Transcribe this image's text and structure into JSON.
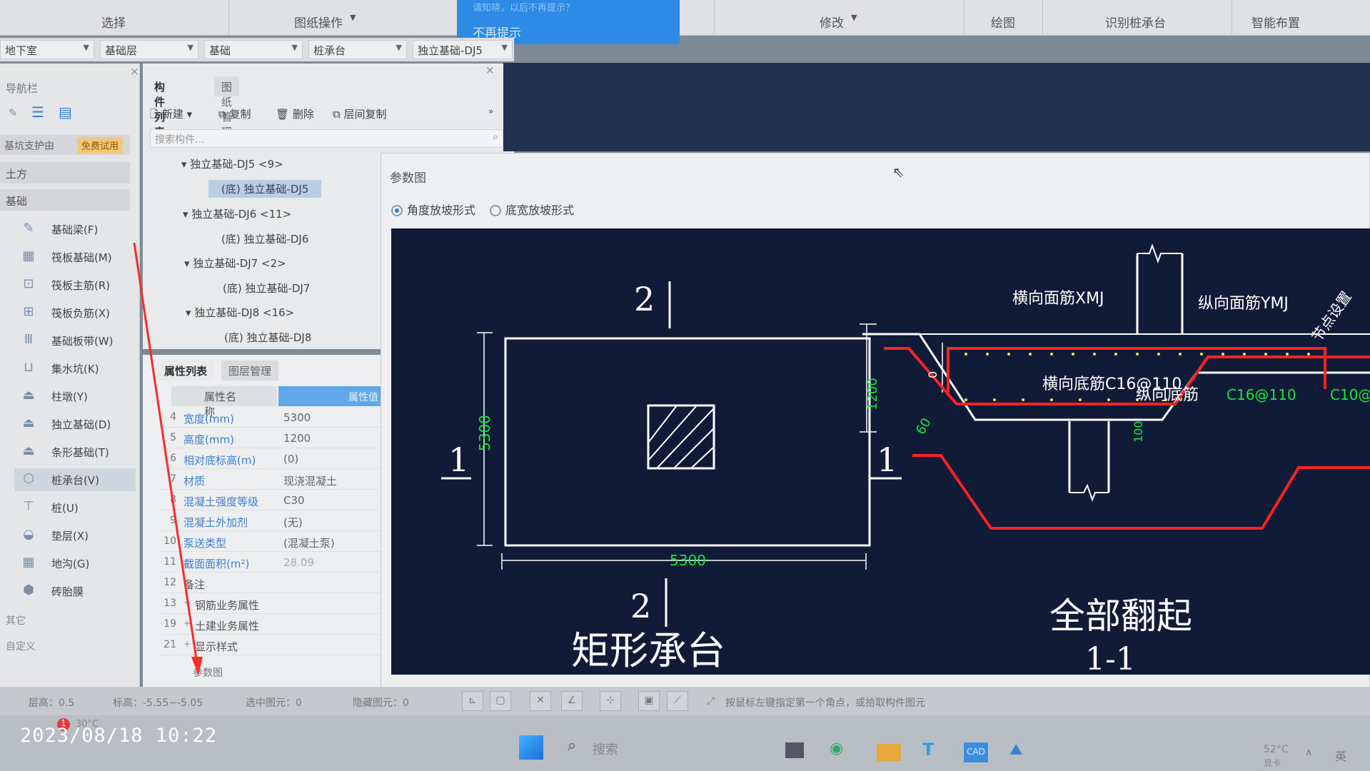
{
  "ribbon": {
    "groups": [
      "选择",
      "图纸操作",
      "修改",
      "绘图",
      "识别桩承台",
      "智能布置"
    ],
    "notice_faded": "请知晓，以后不再提示？",
    "notice_label": "不再提示"
  },
  "selectors": {
    "floor": "地下室",
    "layer": "基础层",
    "type": "基础",
    "subtype": "桩承台",
    "component": "独立基础-DJ5"
  },
  "nav": {
    "title": "导航栏",
    "category_top": "基坑支护由",
    "badge": "免费试用",
    "categories": [
      "土方",
      "基础"
    ],
    "items": [
      {
        "label": "基础梁(F)",
        "icon": "beam-icon"
      },
      {
        "label": "筏板基础(M)",
        "icon": "grid-icon"
      },
      {
        "label": "筏板主筋(R)",
        "icon": "rebar-icon"
      },
      {
        "label": "筏板负筋(X)",
        "icon": "rebar-neg-icon"
      },
      {
        "label": "基础板带(W)",
        "icon": "strip-icon"
      },
      {
        "label": "集水坑(K)",
        "icon": "pit-icon"
      },
      {
        "label": "柱墩(Y)",
        "icon": "pier-icon"
      },
      {
        "label": "独立基础(D)",
        "icon": "footing-icon"
      },
      {
        "label": "条形基础(T)",
        "icon": "strip-footing-icon"
      },
      {
        "label": "桩承台(V)",
        "icon": "pile-cap-icon"
      },
      {
        "label": "桩(U)",
        "icon": "pile-icon"
      },
      {
        "label": "垫层(X)",
        "icon": "cushion-icon"
      },
      {
        "label": "地沟(G)",
        "icon": "trench-icon"
      },
      {
        "label": "砖胎膜",
        "icon": "brick-icon"
      }
    ],
    "others": "其它",
    "custom": "自定义"
  },
  "component_list": {
    "tabs": [
      "构件列表",
      "图纸管理"
    ],
    "toolbar": {
      "new": "新建",
      "copy": "复制",
      "delete": "删除",
      "floor_copy": "层间复制"
    },
    "search_placeholder": "搜索构件...",
    "tree": [
      {
        "group": "独立基础-DJ5 <9>",
        "child": "(底) 独立基础-DJ5"
      },
      {
        "group": "独立基础-DJ6 <11>",
        "child": "(底) 独立基础-DJ6"
      },
      {
        "group": "独立基础-DJ7 <2>",
        "child": "(底) 独立基础-DJ7"
      },
      {
        "group": "独立基础-DJ8 <16>",
        "child": "(底) 独立基础-DJ8"
      }
    ]
  },
  "properties": {
    "tabs": [
      "属性列表",
      "图层管理"
    ],
    "col_name": "属性名称",
    "col_value": "属性值",
    "rows": [
      {
        "n": "4",
        "k": "宽度(mm)",
        "v": "5300"
      },
      {
        "n": "5",
        "k": "高度(mm)",
        "v": "1200"
      },
      {
        "n": "6",
        "k": "相对底标高(m)",
        "v": "(0)"
      },
      {
        "n": "7",
        "k": "材质",
        "v": "现浇混凝土"
      },
      {
        "n": "8",
        "k": "混凝土强度等级",
        "v": "C30"
      },
      {
        "n": "9",
        "k": "混凝土外加剂",
        "v": "(无)"
      },
      {
        "n": "10",
        "k": "泵送类型",
        "v": "(混凝土泵)"
      },
      {
        "n": "11",
        "k": "截面面积(m²)",
        "v": "28.09"
      },
      {
        "n": "12",
        "k": "备注",
        "v": ""
      },
      {
        "n": "13",
        "k": "钢筋业务属性",
        "v": ""
      },
      {
        "n": "19",
        "k": "土建业务属性",
        "v": ""
      },
      {
        "n": "21",
        "k": "显示样式",
        "v": ""
      }
    ],
    "footer_link": "参数图"
  },
  "param_dialog": {
    "title": "参数图",
    "radio_angle": "角度放坡形式",
    "radio_width": "底宽放坡形式",
    "plan": {
      "dim_h": "5300",
      "dim_v": "5300",
      "sec2": "2",
      "sec1": "1",
      "caption": "矩形承台"
    },
    "section": {
      "top_bar_h": "横向面筋XMJ",
      "top_bar_v": "纵向面筋YMJ",
      "bottom_bar_h": "横向底筋C16@110",
      "bottom_bar_v": "纵向底筋",
      "bottom_bar_v_val": "C16@110",
      "bottom_bar_v_right": "C10@",
      "side_note": "节点设置",
      "dim_height": "1200",
      "dim_zero": "0",
      "dim_angle": "60",
      "dim_100": "100",
      "caption": "全部翻起",
      "section_id": "1-1"
    }
  },
  "status": {
    "layer_height": "层高：0.5",
    "elevation": "标高：-5.55~-5.05",
    "selected": "选中图元：0",
    "hidden": "隐藏图元：0",
    "hint": "按鼠标左键指定第一个角点，或拾取构件图元"
  },
  "taskbar": {
    "weather": "30°C",
    "search": "搜索",
    "temp": "52°C",
    "temp_sub": "显卡",
    "lang": "英",
    "timestamp": "2023/08/18 10:22"
  }
}
